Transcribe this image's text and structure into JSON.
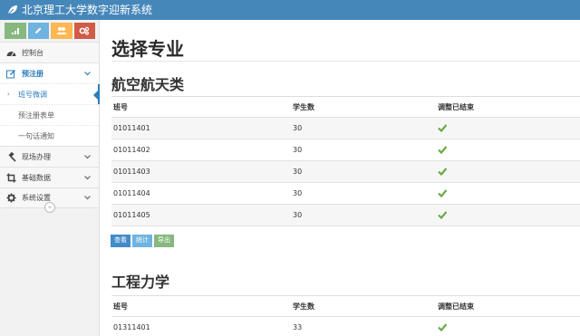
{
  "app": {
    "title": "北京理工大学数字迎新系统"
  },
  "shortcuts": [
    {
      "icon": "signal-icon",
      "color": "#87b87f"
    },
    {
      "icon": "pencil-icon",
      "color": "#6fb3e0"
    },
    {
      "icon": "users-icon",
      "color": "#ffb752"
    },
    {
      "icon": "cogs-icon",
      "color": "#d15b47"
    }
  ],
  "sidebar": {
    "items": [
      {
        "label": "控制台",
        "icon": "dashboard-icon"
      },
      {
        "label": "预注册",
        "icon": "edit-icon",
        "open": true
      },
      {
        "label": "现场办理",
        "icon": "gavel-icon"
      },
      {
        "label": "基础数据",
        "icon": "crop-icon"
      },
      {
        "label": "系统设置",
        "icon": "gear-icon"
      }
    ],
    "subitems": [
      {
        "label": "班号微调",
        "active": true
      },
      {
        "label": "预注册表单"
      },
      {
        "label": "一句话通知"
      }
    ],
    "collapse_symbol": "«"
  },
  "page": {
    "title": "选择专业"
  },
  "sections": [
    {
      "title": "航空航天类",
      "headers": [
        "班号",
        "学生数",
        "调整已结束"
      ],
      "rows": [
        {
          "id": "01011401",
          "count": "30",
          "done": true
        },
        {
          "id": "01011402",
          "count": "30",
          "done": true
        },
        {
          "id": "01011403",
          "count": "30",
          "done": true
        },
        {
          "id": "01011404",
          "count": "30",
          "done": true
        },
        {
          "id": "01011405",
          "count": "30",
          "done": true
        }
      ],
      "buttons": {
        "view": "查看",
        "stat": "统计",
        "export": "导出"
      }
    },
    {
      "title": "工程力学",
      "headers": [
        "班号",
        "学生数",
        "调整已结束"
      ],
      "rows": [
        {
          "id": "01311401",
          "count": "33",
          "done": true
        }
      ]
    }
  ],
  "colors": {
    "topbar": "#4687ba",
    "accent": "#2b7dbc",
    "check": "#69aa46"
  }
}
